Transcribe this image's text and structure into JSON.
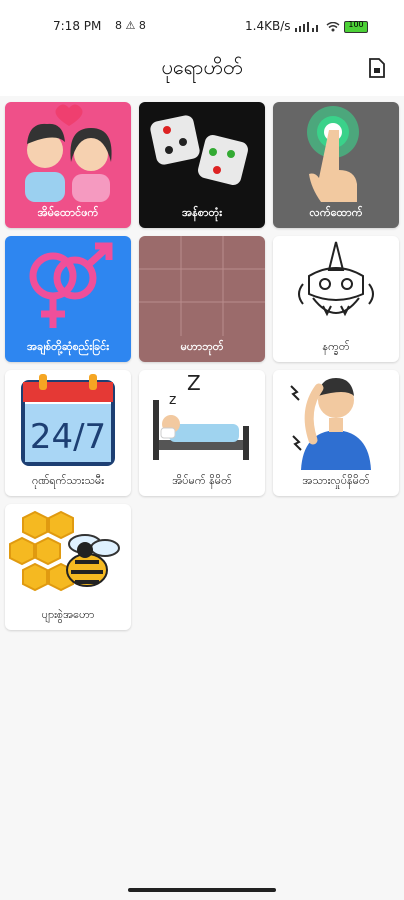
{
  "status": {
    "time": "7:18 PM",
    "left_icons": "8 ⚠ 8",
    "network": "1.4KB/s",
    "battery": "100"
  },
  "header": {
    "title": "ပုရောဟိတ်",
    "action_icon": "document-icon"
  },
  "tiles": [
    {
      "label": "အိမ်ထောင်ဖက်",
      "icon": "couple-icon",
      "bg": "#ef5089"
    },
    {
      "label": "အန်စာတုံး",
      "icon": "dice-icon",
      "bg": "#111111"
    },
    {
      "label": "လက်ထောက်",
      "icon": "finger-tap-icon",
      "bg": "#666666"
    },
    {
      "label": "အချစ်တို့ဆုံစည်းခြင်း",
      "icon": "gender-symbols-icon",
      "bg": "#2e86f0"
    },
    {
      "label": "မဟာဘုတ်",
      "icon": "grid-board-icon",
      "bg": "#9b6b6b"
    },
    {
      "label": "နက္ခတ်",
      "icon": "ogre-mask-icon",
      "bg": "#ffffff"
    },
    {
      "label": "ဂုဏ်ရက်သားသမီး",
      "icon": "calendar-24-7-icon",
      "bg": "#ffffff"
    },
    {
      "label": "အိပ်မက် နိမိတ်",
      "icon": "sleeping-icon",
      "bg": "#ffffff"
    },
    {
      "label": "အသားလှုပ်နိမိတ်",
      "icon": "twitching-man-icon",
      "bg": "#ffffff"
    },
    {
      "label": "ပျားစွဲအဟော",
      "icon": "bee-honeycomb-icon",
      "bg": "#ffffff"
    }
  ],
  "calendar_text": "24/7"
}
